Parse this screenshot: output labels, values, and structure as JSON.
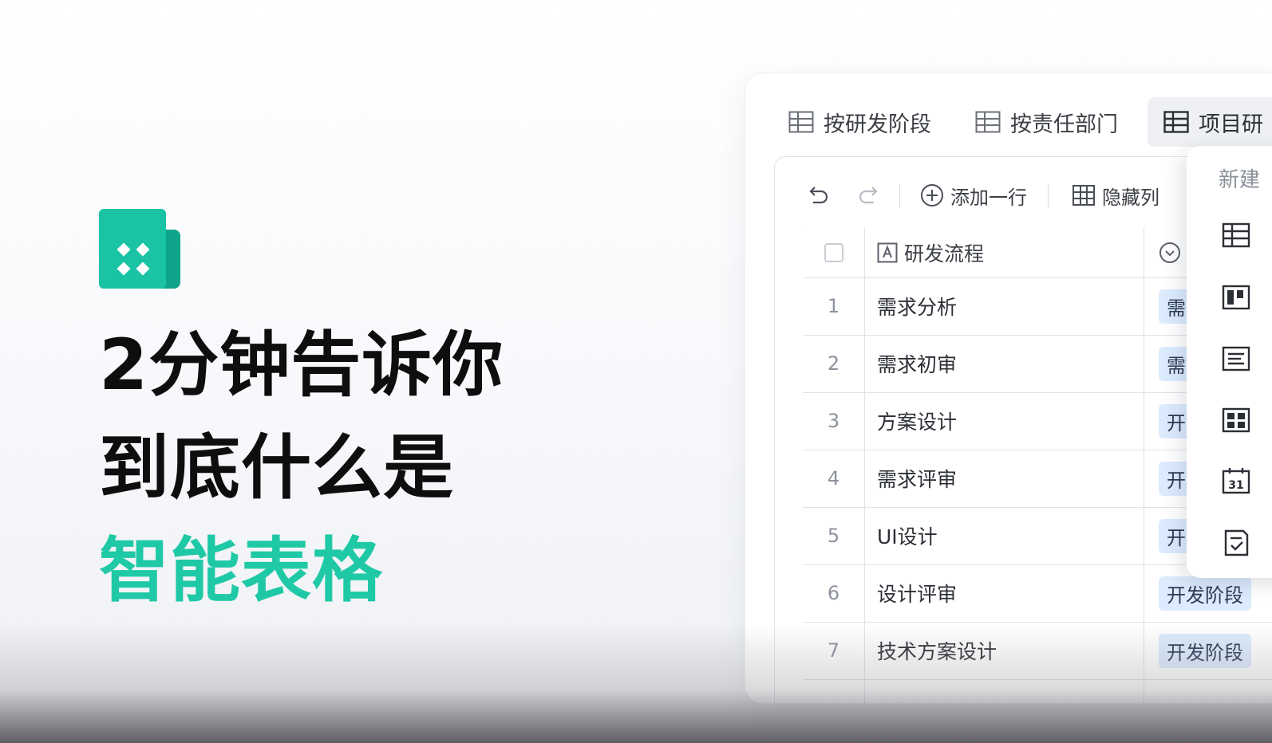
{
  "hero": {
    "line1": "2分钟告诉你",
    "line2": "到底什么是",
    "line3": "智能表格",
    "accent_color": "#1fc9a6",
    "logo_icon": "smart-sheet-logo"
  },
  "tabs": [
    {
      "label": "按研发阶段",
      "icon": "table-icon"
    },
    {
      "label": "按责任部门",
      "icon": "table-icon"
    },
    {
      "label": "项目研",
      "icon": "table-icon",
      "active": true
    }
  ],
  "toolbar": {
    "undo_icon": "undo-icon",
    "redo_icon": "redo-icon",
    "add_row_label": "添加一行",
    "hide_column_label": "隐藏列"
  },
  "table": {
    "columns": [
      {
        "label": "研发流程",
        "icon": "text-field-icon"
      },
      {
        "label": "",
        "icon": "single-select-icon"
      }
    ],
    "rows": [
      {
        "index": "1",
        "name": "需求分析",
        "tag": "需"
      },
      {
        "index": "2",
        "name": "需求初审",
        "tag": "需"
      },
      {
        "index": "3",
        "name": "方案设计",
        "tag": "开"
      },
      {
        "index": "4",
        "name": "需求评审",
        "tag": "开"
      },
      {
        "index": "5",
        "name": "UI设计",
        "tag": "开"
      },
      {
        "index": "6",
        "name": "设计评审",
        "tag": "开发阶段"
      },
      {
        "index": "7",
        "name": "技术方案设计",
        "tag": "开发阶段"
      }
    ]
  },
  "dropdown": {
    "header": "新建",
    "items": [
      {
        "icon": "grid-view-icon"
      },
      {
        "icon": "kanban-view-icon"
      },
      {
        "icon": "form-view-icon"
      },
      {
        "icon": "gallery-view-icon"
      },
      {
        "icon": "calendar-view-icon",
        "text": "31"
      },
      {
        "icon": "gantt-checklist-icon"
      }
    ]
  }
}
